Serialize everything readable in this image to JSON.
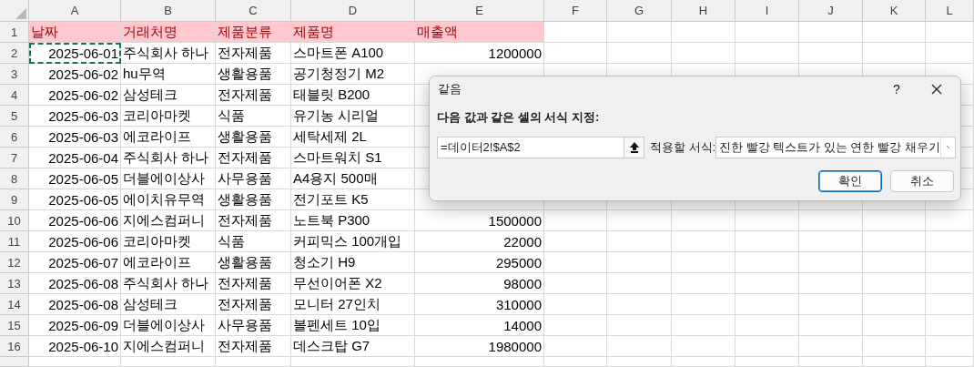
{
  "sheet": {
    "columns": [
      {
        "label": "A",
        "kind": "date"
      },
      {
        "label": "B",
        "kind": "text"
      },
      {
        "label": "C",
        "kind": "text"
      },
      {
        "label": "D",
        "kind": "text"
      },
      {
        "label": "E",
        "kind": "number"
      },
      {
        "label": "F"
      },
      {
        "label": "G"
      },
      {
        "label": "H"
      },
      {
        "label": "I"
      },
      {
        "label": "J"
      },
      {
        "label": "K"
      },
      {
        "label": "L"
      }
    ],
    "rows": [
      {
        "number": "1",
        "kind": "header",
        "highlighted": true,
        "cells": [
          {
            "value": "날짜",
            "selected": false
          },
          {
            "value": "거래처명",
            "selected": false
          },
          {
            "value": "제품분류",
            "selected": false
          },
          {
            "value": "제품명",
            "selected": false
          },
          {
            "value": "매출액",
            "selected": false
          }
        ]
      },
      {
        "number": "2",
        "kind": "data",
        "highlighted": false,
        "cells": [
          {
            "value": "2025-06-01",
            "selected": true
          },
          {
            "value": "주식회사 하나",
            "selected": false
          },
          {
            "value": "전자제품",
            "selected": false
          },
          {
            "value": "스마트폰 A100",
            "selected": false
          },
          {
            "value": "1200000",
            "selected": false
          }
        ]
      },
      {
        "number": "3",
        "kind": "data",
        "highlighted": false,
        "cells": [
          {
            "value": "2025-06-02",
            "selected": false
          },
          {
            "value": "hu무역",
            "selected": false
          },
          {
            "value": "생활용품",
            "selected": false
          },
          {
            "value": "공기청정기 M2",
            "selected": false
          }
        ]
      },
      {
        "number": "4",
        "kind": "data",
        "highlighted": false,
        "cells": [
          {
            "value": "2025-06-02",
            "selected": false
          },
          {
            "value": "삼성테크",
            "selected": false
          },
          {
            "value": "전자제품",
            "selected": false
          },
          {
            "value": "태블릿 B200",
            "selected": false
          }
        ]
      },
      {
        "number": "5",
        "kind": "data",
        "highlighted": false,
        "cells": [
          {
            "value": "2025-06-03",
            "selected": false
          },
          {
            "value": "코리아마켓",
            "selected": false
          },
          {
            "value": "식품",
            "selected": false
          },
          {
            "value": "유기농 시리얼",
            "selected": false
          }
        ]
      },
      {
        "number": "6",
        "kind": "data",
        "highlighted": false,
        "cells": [
          {
            "value": "2025-06-03",
            "selected": false
          },
          {
            "value": "에코라이프",
            "selected": false
          },
          {
            "value": "생활용품",
            "selected": false
          },
          {
            "value": "세탁세제 2L",
            "selected": false
          }
        ]
      },
      {
        "number": "7",
        "kind": "data",
        "highlighted": false,
        "cells": [
          {
            "value": "2025-06-04",
            "selected": false
          },
          {
            "value": "주식회사 하나",
            "selected": false
          },
          {
            "value": "전자제품",
            "selected": false
          },
          {
            "value": "스마트워치 S1",
            "selected": false
          }
        ]
      },
      {
        "number": "8",
        "kind": "data",
        "highlighted": false,
        "cells": [
          {
            "value": "2025-06-05",
            "selected": false
          },
          {
            "value": "더블에이상사",
            "selected": false
          },
          {
            "value": "사무용품",
            "selected": false
          },
          {
            "value": "A4용지 500매",
            "selected": false
          }
        ]
      },
      {
        "number": "9",
        "kind": "data",
        "highlighted": false,
        "cells": [
          {
            "value": "2025-06-05",
            "selected": false
          },
          {
            "value": "에이치유무역",
            "selected": false
          },
          {
            "value": "생활용품",
            "selected": false
          },
          {
            "value": "전기포트 K5",
            "selected": false
          }
        ]
      },
      {
        "number": "10",
        "kind": "data",
        "highlighted": false,
        "cells": [
          {
            "value": "2025-06-06",
            "selected": false
          },
          {
            "value": "지에스컴퍼니",
            "selected": false
          },
          {
            "value": "전자제품",
            "selected": false
          },
          {
            "value": "노트북 P300",
            "selected": false
          },
          {
            "value": "1500000",
            "selected": false
          }
        ]
      },
      {
        "number": "11",
        "kind": "data",
        "highlighted": false,
        "cells": [
          {
            "value": "2025-06-06",
            "selected": false
          },
          {
            "value": "코리아마켓",
            "selected": false
          },
          {
            "value": "식품",
            "selected": false
          },
          {
            "value": "커피믹스 100개입",
            "selected": false
          },
          {
            "value": "22000",
            "selected": false
          }
        ]
      },
      {
        "number": "12",
        "kind": "data",
        "highlighted": false,
        "cells": [
          {
            "value": "2025-06-07",
            "selected": false
          },
          {
            "value": "에코라이프",
            "selected": false
          },
          {
            "value": "생활용품",
            "selected": false
          },
          {
            "value": "청소기 H9",
            "selected": false
          },
          {
            "value": "295000",
            "selected": false
          }
        ]
      },
      {
        "number": "13",
        "kind": "data",
        "highlighted": false,
        "cells": [
          {
            "value": "2025-06-08",
            "selected": false
          },
          {
            "value": "주식회사 하나",
            "selected": false
          },
          {
            "value": "전자제품",
            "selected": false
          },
          {
            "value": "무선이어폰 X2",
            "selected": false
          },
          {
            "value": "98000",
            "selected": false
          }
        ]
      },
      {
        "number": "14",
        "kind": "data",
        "highlighted": false,
        "cells": [
          {
            "value": "2025-06-08",
            "selected": false
          },
          {
            "value": "삼성테크",
            "selected": false
          },
          {
            "value": "전자제품",
            "selected": false
          },
          {
            "value": "모니터 27인치",
            "selected": false
          },
          {
            "value": "310000",
            "selected": false
          }
        ]
      },
      {
        "number": "15",
        "kind": "data",
        "highlighted": false,
        "cells": [
          {
            "value": "2025-06-09",
            "selected": false
          },
          {
            "value": "더블에이상사",
            "selected": false
          },
          {
            "value": "사무용품",
            "selected": false
          },
          {
            "value": "볼펜세트 10입",
            "selected": false
          },
          {
            "value": "14000",
            "selected": false
          }
        ]
      },
      {
        "number": "16",
        "kind": "data",
        "highlighted": false,
        "cells": [
          {
            "value": "2025-06-10",
            "selected": false
          },
          {
            "value": "지에스컴퍼니",
            "selected": false
          },
          {
            "value": "전자제품",
            "selected": false
          },
          {
            "value": "데스크탑 G7",
            "selected": false
          },
          {
            "value": "1980000",
            "selected": false
          }
        ]
      }
    ]
  },
  "dialog": {
    "title": "같음",
    "help": "?",
    "prompt": "다음 값과 같은 셀의 서식 지정:",
    "input": {
      "value": "=데이터2!$A$2"
    },
    "format_label": "적용할 서식:",
    "format_select": {
      "value": "진한 빨강 텍스트가 있는 연한 빨강 채우기"
    },
    "buttons": [
      {
        "label": "확인",
        "default": true
      },
      {
        "label": "취소",
        "default": false
      }
    ]
  }
}
